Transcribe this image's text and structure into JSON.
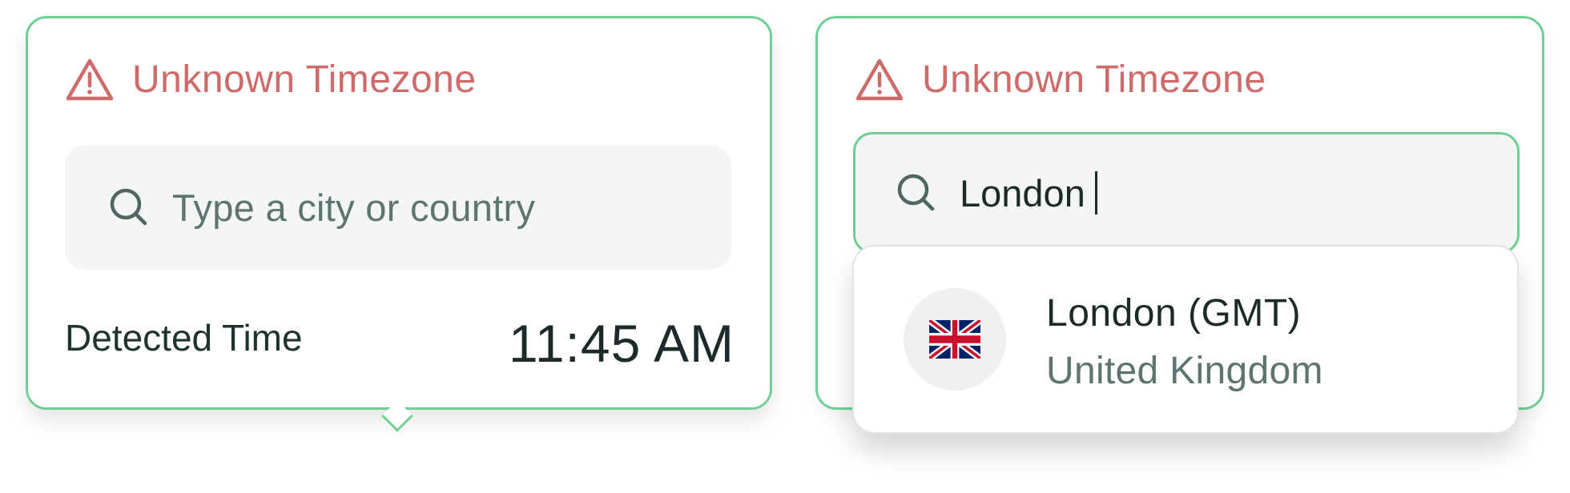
{
  "left_panel": {
    "title": "Unknown Timezone",
    "title_icon": "warning-icon",
    "search": {
      "placeholder": "Type a city or country",
      "value": "",
      "icon": "search-icon"
    },
    "detected_label": "Detected Time",
    "detected_value": "11:45 AM"
  },
  "right_panel": {
    "title": "Unknown Timezone",
    "title_icon": "warning-icon",
    "search": {
      "value": "London",
      "icon": "search-icon"
    },
    "results": [
      {
        "city": "London (GMT)",
        "country": "United Kingdom",
        "icon": "uk-flag-icon"
      }
    ]
  },
  "colors": {
    "accent_border": "#6fcf97",
    "warning": "#cd6b6b",
    "input_bg": "#f3f6f5",
    "text_primary": "#1c2b29",
    "text_secondary": "#5d7470"
  }
}
